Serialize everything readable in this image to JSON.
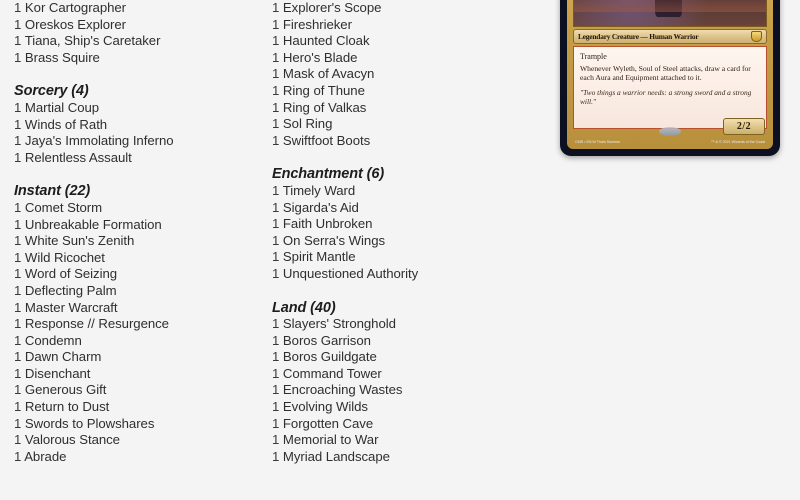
{
  "page": {
    "background_color": "#f4f4f4",
    "text_color": "#3a3a3a"
  },
  "columns": [
    {
      "name": "left-column",
      "sections": [
        {
          "header": null,
          "continued": true,
          "cards": [
            {
              "qty": "1",
              "name": "Kor Cartographer"
            },
            {
              "qty": "1",
              "name": "Oreskos Explorer"
            },
            {
              "qty": "1",
              "name": "Tiana, Ship's Caretaker"
            },
            {
              "qty": "1",
              "name": "Brass Squire"
            }
          ]
        },
        {
          "header": "Sorcery (4)",
          "continued": false,
          "cards": [
            {
              "qty": "1",
              "name": "Martial Coup"
            },
            {
              "qty": "1",
              "name": "Winds of Rath"
            },
            {
              "qty": "1",
              "name": "Jaya's Immolating Inferno"
            },
            {
              "qty": "1",
              "name": "Relentless Assault"
            }
          ]
        },
        {
          "header": "Instant (22)",
          "continued": false,
          "cards": [
            {
              "qty": "1",
              "name": "Comet Storm"
            },
            {
              "qty": "1",
              "name": "Unbreakable Formation"
            },
            {
              "qty": "1",
              "name": "White Sun's Zenith"
            },
            {
              "qty": "1",
              "name": "Wild Ricochet"
            },
            {
              "qty": "1",
              "name": "Word of Seizing"
            },
            {
              "qty": "1",
              "name": "Deflecting Palm"
            },
            {
              "qty": "1",
              "name": "Master Warcraft"
            },
            {
              "qty": "1",
              "name": "Response // Resurgence"
            },
            {
              "qty": "1",
              "name": "Condemn"
            },
            {
              "qty": "1",
              "name": "Dawn Charm"
            },
            {
              "qty": "1",
              "name": "Disenchant"
            },
            {
              "qty": "1",
              "name": "Generous Gift"
            },
            {
              "qty": "1",
              "name": "Return to Dust"
            },
            {
              "qty": "1",
              "name": "Swords to Plowshares"
            },
            {
              "qty": "1",
              "name": "Valorous Stance"
            },
            {
              "qty": "1",
              "name": "Abrade"
            }
          ]
        }
      ]
    },
    {
      "name": "right-column",
      "sections": [
        {
          "header": null,
          "continued": true,
          "cards": [
            {
              "qty": "1",
              "name": "Explorer's Scope"
            },
            {
              "qty": "1",
              "name": "Fireshrieker"
            },
            {
              "qty": "1",
              "name": "Haunted Cloak"
            },
            {
              "qty": "1",
              "name": "Hero's Blade"
            },
            {
              "qty": "1",
              "name": "Mask of Avacyn"
            },
            {
              "qty": "1",
              "name": "Ring of Thune"
            },
            {
              "qty": "1",
              "name": "Ring of Valkas"
            },
            {
              "qty": "1",
              "name": "Sol Ring"
            },
            {
              "qty": "1",
              "name": "Swiftfoot Boots"
            }
          ]
        },
        {
          "header": "Enchantment (6)",
          "continued": false,
          "cards": [
            {
              "qty": "1",
              "name": "Timely Ward"
            },
            {
              "qty": "1",
              "name": "Sigarda's Aid"
            },
            {
              "qty": "1",
              "name": "Faith Unbroken"
            },
            {
              "qty": "1",
              "name": "On Serra's Wings"
            },
            {
              "qty": "1",
              "name": "Spirit Mantle"
            },
            {
              "qty": "1",
              "name": "Unquestioned Authority"
            }
          ]
        },
        {
          "header": "Land (40)",
          "continued": false,
          "cards": [
            {
              "qty": "1",
              "name": "Slayers' Stronghold"
            },
            {
              "qty": "1",
              "name": "Boros Garrison"
            },
            {
              "qty": "1",
              "name": "Boros Guildgate"
            },
            {
              "qty": "1",
              "name": "Command Tower"
            },
            {
              "qty": "1",
              "name": "Encroaching Wastes"
            },
            {
              "qty": "1",
              "name": "Evolving Wilds"
            },
            {
              "qty": "1",
              "name": "Forgotten Cave"
            },
            {
              "qty": "1",
              "name": "Memorial to War"
            },
            {
              "qty": "1",
              "name": "Myriad Landscape"
            }
          ]
        }
      ]
    }
  ],
  "card_preview": {
    "name": "card-preview",
    "type_line": "Legendary Creature — Human Warrior",
    "keyword": "Trample",
    "rules_text": "Whenever Wyleth, Soul of Steel attacks, draw a card for each Aura and Equipment attached to it.",
    "flavor_text": "\"Two things a warrior needs: a strong sword and a strong will.\"",
    "power_toughness": "2/2",
    "footer_left": "002",
    "footer_left_2": "CMR • EN  W Thain Sommer",
    "footer_right": "™ & © 2021 Wizards of the Coast",
    "frame_color": "#c79f47",
    "textbox_color": "#fbeee6",
    "border_color": "#0d1020"
  }
}
